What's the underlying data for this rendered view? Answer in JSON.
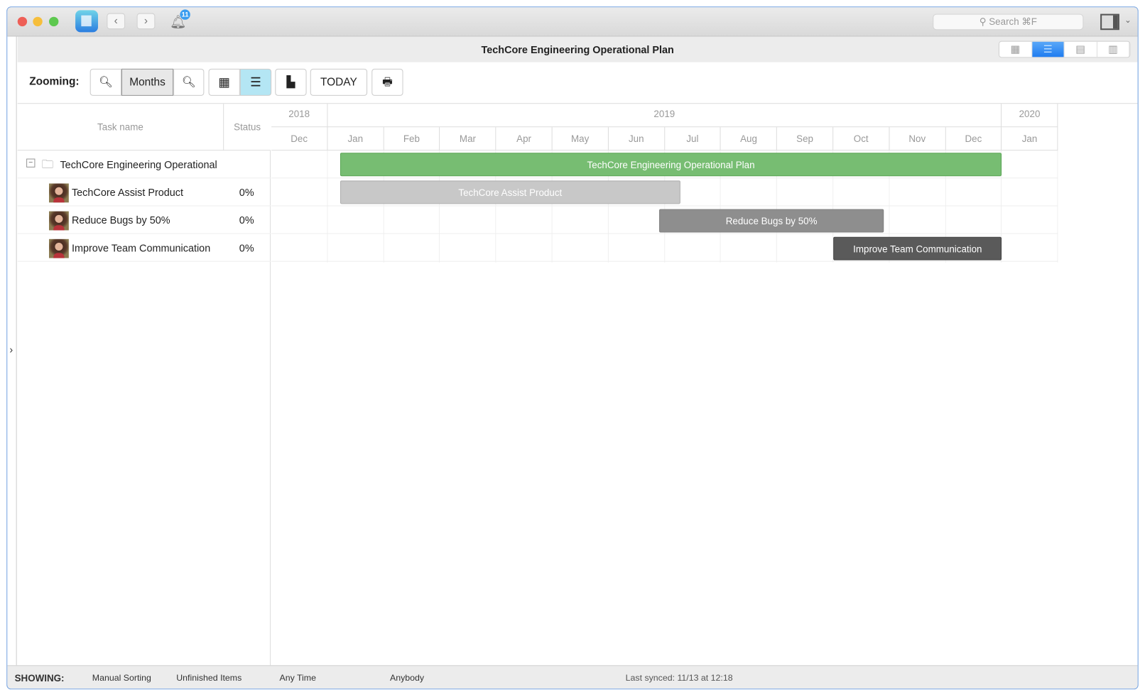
{
  "titlebar": {
    "notifications": "11",
    "search_placeholder": "Search ⌘F"
  },
  "header": {
    "title": "TechCore Engineering Operational Plan",
    "views": [
      "grid-view",
      "gantt-view",
      "calendar-view",
      "report-view"
    ],
    "active_view": "gantt-view"
  },
  "toolbar": {
    "zooming_label": "Zooming:",
    "zoom_level": "Months",
    "today": "TODAY"
  },
  "table": {
    "col_task": "Task name",
    "col_status": "Status",
    "rows": [
      {
        "name": "TechCore Engineering Operational",
        "status": ""
      },
      {
        "name": "TechCore Assist Product",
        "status": "0%"
      },
      {
        "name": "Reduce Bugs by 50%",
        "status": "0%"
      },
      {
        "name": "Improve Team Communication",
        "status": "0%"
      }
    ]
  },
  "timeline": {
    "years": [
      {
        "label": "2018",
        "span": 1
      },
      {
        "label": "2019",
        "span": 12
      },
      {
        "label": "2020",
        "span": 1
      }
    ],
    "months": [
      "Dec",
      "Jan",
      "Feb",
      "Mar",
      "Apr",
      "May",
      "Jun",
      "Jul",
      "Aug",
      "Sep",
      "Oct",
      "Nov",
      "Dec",
      "Jan"
    ],
    "bars": [
      {
        "label": "TechCore Engineering Operational Plan",
        "start_month": 1.22,
        "end_month": 13.0,
        "color": "#77bd72",
        "border": "#5aa555"
      },
      {
        "label": "TechCore Assist Product",
        "start_month": 1.22,
        "end_month": 7.28,
        "color": "#c8c8c8",
        "border": "#b0b0b0"
      },
      {
        "label": "Reduce Bugs by 50%",
        "start_month": 6.9,
        "end_month": 10.9,
        "color": "#8e8e8e",
        "border": "#808080"
      },
      {
        "label": "Improve Team Communication",
        "start_month": 10.0,
        "end_month": 13.0,
        "color": "#5a5a5a",
        "border": "#444444"
      }
    ]
  },
  "footer": {
    "showing": "SHOWING:",
    "sorting": "Manual Sorting",
    "items": "Unfinished Items",
    "time": "Any Time",
    "who": "Anybody",
    "synced": "Last synced: 11/13 at 12:18"
  }
}
